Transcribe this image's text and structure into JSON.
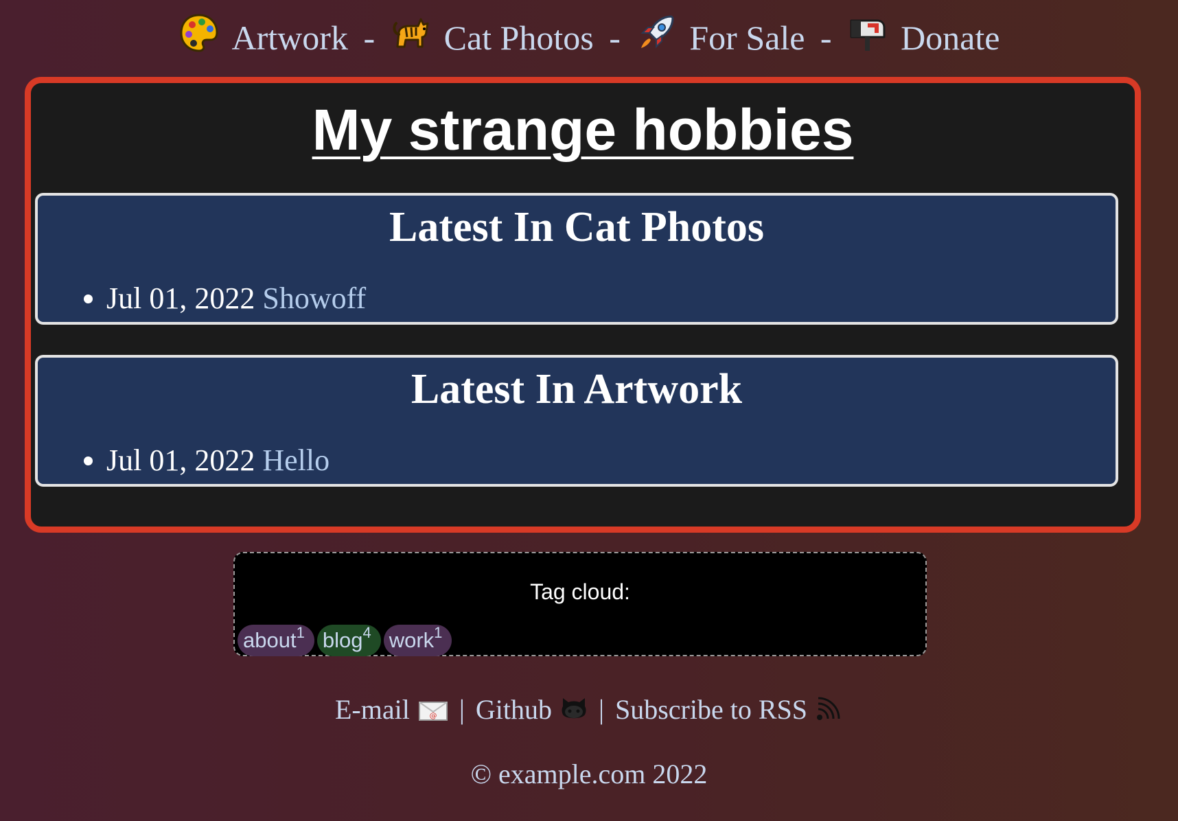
{
  "nav": {
    "items": [
      {
        "label": "Artwork",
        "icon": "palette-icon"
      },
      {
        "label": "Cat Photos",
        "icon": "cat-icon"
      },
      {
        "label": "For Sale",
        "icon": "rocket-icon"
      },
      {
        "label": "Donate",
        "icon": "mailbox-icon"
      }
    ],
    "separator": "-"
  },
  "site": {
    "title": "My strange hobbies"
  },
  "sections": [
    {
      "heading": "Latest In Cat Photos",
      "posts": [
        {
          "date": "Jul 01, 2022",
          "title": "Showoff"
        }
      ]
    },
    {
      "heading": "Latest In Artwork",
      "posts": [
        {
          "date": "Jul 01, 2022",
          "title": "Hello"
        }
      ]
    }
  ],
  "tag_cloud": {
    "title": "Tag cloud:",
    "tags": [
      {
        "name": "about",
        "count": "1",
        "color": "#4b2f52"
      },
      {
        "name": "blog",
        "count": "4",
        "color": "#1f4a25"
      },
      {
        "name": "work",
        "count": "1",
        "color": "#4b2f52"
      }
    ]
  },
  "footer": {
    "links": [
      {
        "label": "E-mail",
        "icon": "envelope-icon"
      },
      {
        "label": "Github",
        "icon": "github-icon"
      },
      {
        "label": "Subscribe to RSS",
        "icon": "rss-icon"
      }
    ],
    "divider": "|",
    "copyright": "© example.com 2022"
  },
  "colors": {
    "panel_border": "#d83a26",
    "card_background": "#22355a",
    "link": "#b5cdec"
  }
}
